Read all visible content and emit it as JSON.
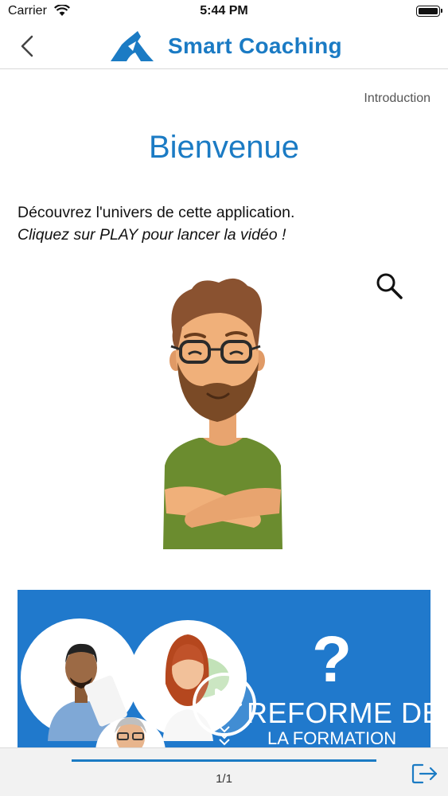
{
  "status_bar": {
    "carrier": "Carrier",
    "time": "5:44 PM",
    "icons": [
      "wifi-icon",
      "battery-icon"
    ]
  },
  "nav": {
    "back_icon": "chevron-left-icon",
    "app_name": "Smart Coaching",
    "brand_color": "#1b7bc4"
  },
  "content": {
    "section_label": "Introduction",
    "title": "Bienvenue",
    "intro_text": "Découvrez l'univers de cette application.",
    "hint_text": "Cliquez sur PLAY pour lancer la vidéo !",
    "zoom_icon": "magnifier-icon"
  },
  "video": {
    "title_line1": "REFORME DE",
    "title_line2": "LA FORMATION",
    "question_mark": "?",
    "play_icon": "play-icon",
    "banner_color": "#2079cc"
  },
  "footer": {
    "page_indicator": "1/1",
    "progress_fraction": 1.0,
    "exit_icon": "exit-icon"
  }
}
